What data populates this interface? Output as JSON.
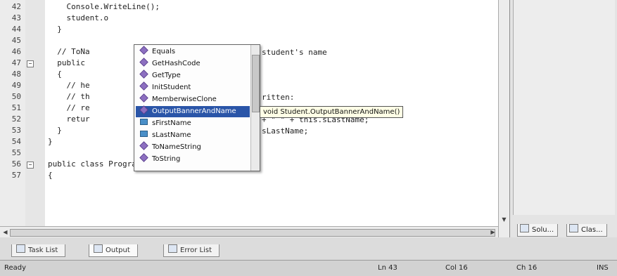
{
  "editor": {
    "lines": [
      {
        "num": "42",
        "text": "    Console.WriteLine();"
      },
      {
        "num": "43",
        "text": "    student.o"
      },
      {
        "num": "44",
        "text": "  }"
      },
      {
        "num": "45",
        "text": ""
      },
      {
        "num": "46",
        "text": "  // ToNa"
      },
      {
        "num": "47",
        "text": "  public"
      },
      {
        "num": "48",
        "text": "  {"
      },
      {
        "num": "49",
        "text": "    // he"
      },
      {
        "num": "50",
        "text": "    // th"
      },
      {
        "num": "51",
        "text": "    // re"
      },
      {
        "num": "52",
        "text": "    retur"
      },
      {
        "num": "53",
        "text": "  }"
      },
      {
        "num": "54",
        "text": "}"
      },
      {
        "num": "55",
        "text": ""
      },
      {
        "num": "56",
        "text": "public class Program"
      },
      {
        "num": "57",
        "text": "{"
      }
    ],
    "right_fragments": {
      "line46": "student's name",
      "line50": "ritten:",
      "line51": "+ \" \" + this.sLastName;",
      "line52": "sLastName;"
    }
  },
  "intellisense": {
    "items": [
      {
        "label": "Equals",
        "kind": "method"
      },
      {
        "label": "GetHashCode",
        "kind": "method"
      },
      {
        "label": "GetType",
        "kind": "method"
      },
      {
        "label": "InitStudent",
        "kind": "method"
      },
      {
        "label": "MemberwiseClone",
        "kind": "method"
      },
      {
        "label": "OutputBannerAndName",
        "kind": "method"
      },
      {
        "label": "sFirstName",
        "kind": "field"
      },
      {
        "label": "sLastName",
        "kind": "field"
      },
      {
        "label": "ToNameString",
        "kind": "method"
      },
      {
        "label": "ToString",
        "kind": "method"
      }
    ],
    "selected": "OutputBannerAndName",
    "tooltip": "void Student.OutputBannerAndName()"
  },
  "side_panel": {
    "tabs": [
      {
        "label": "Solu...",
        "icon": "solution-explorer-icon"
      },
      {
        "label": "Clas...",
        "icon": "class-view-icon"
      }
    ]
  },
  "tool_tabs": [
    {
      "label": "Task List",
      "icon": "task-list-icon"
    },
    {
      "label": "Output",
      "icon": "output-icon"
    },
    {
      "label": "Error List",
      "icon": "error-list-icon"
    }
  ],
  "status": {
    "ready": "Ready",
    "ln": "Ln 43",
    "col": "Col 16",
    "ch": "Ch 16",
    "mode": "INS"
  },
  "colors": {
    "selection": "#2a55a8",
    "tooltip_bg": "#ffffe6"
  }
}
